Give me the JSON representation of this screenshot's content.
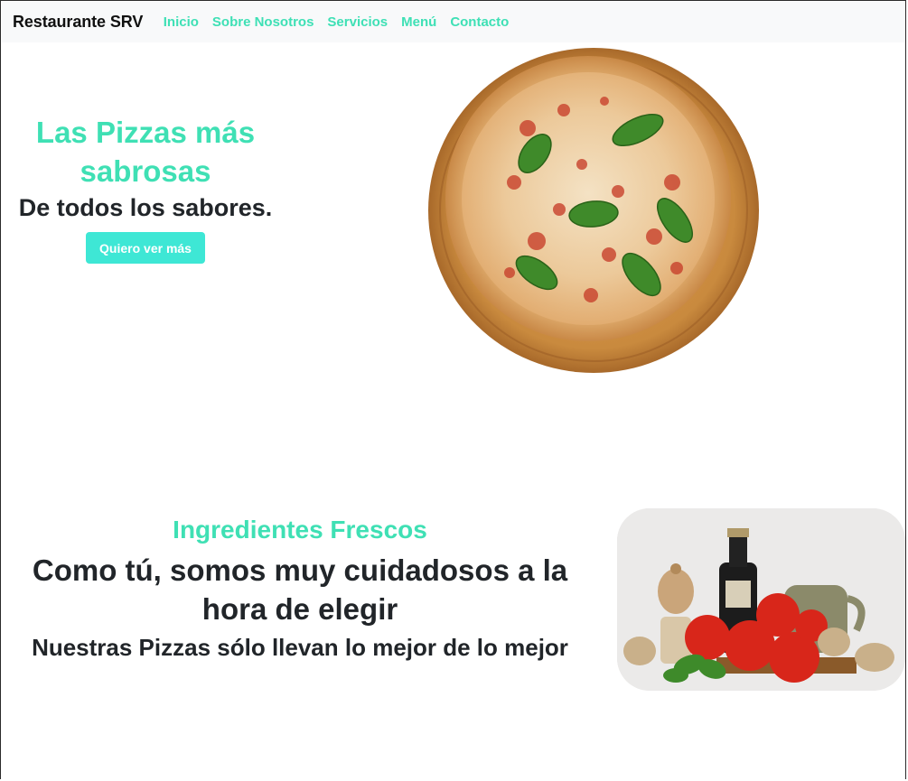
{
  "navbar": {
    "brand": "Restaurante SRV",
    "links": [
      "Inicio",
      "Sobre Nosotros",
      "Servicios",
      "Menú",
      "Contacto"
    ]
  },
  "hero": {
    "title": "Las Pizzas más sabrosas",
    "subtitle": "De todos los sabores.",
    "button_label": "Quiero ver más"
  },
  "ingredients_section": {
    "kicker": "Ingredientes Frescos",
    "title": "Como tú, somos muy cuidadosos a la hora de elegir",
    "subtitle": "Nuestras Pizzas sólo llevan lo mejor de lo mejor"
  },
  "colors": {
    "accent": "#3fe0b4",
    "button": "#3ee7d5",
    "navbar_bg": "#f8f9fa",
    "text": "#212529"
  },
  "icons": {
    "hero_image": "pizza-image",
    "section_image": "ingredients-image"
  }
}
